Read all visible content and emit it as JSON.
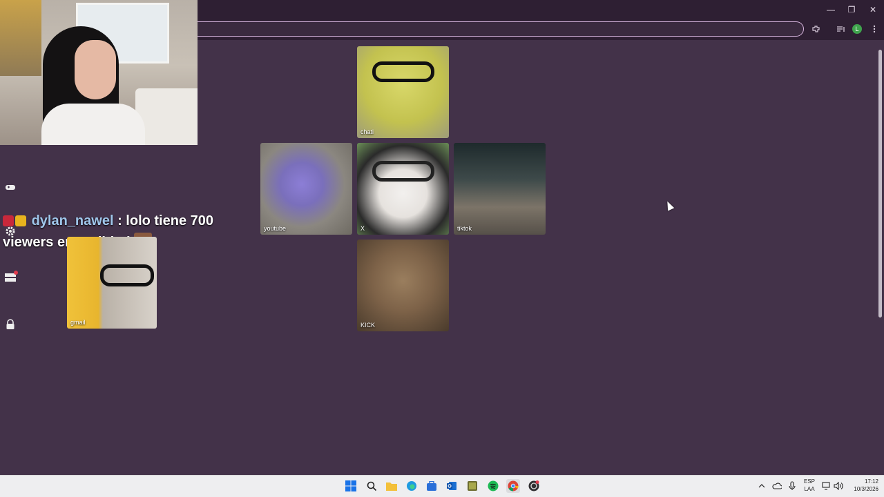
{
  "window": {
    "minimize_glyph": "—",
    "maximize_glyph": "❐",
    "close_glyph": "✕"
  },
  "toolbar": {
    "address_value": "",
    "icons": [
      "extensions-icon",
      "media-control-icon",
      "profile-avatar",
      "menu-icon"
    ],
    "profile_initial": "L"
  },
  "chat": {
    "username": "dylan_nawel",
    "separator": ":",
    "message_line1": "lolo tiene 700",
    "message_line2": "viewers en realidad"
  },
  "tiles": [
    {
      "label": "chati"
    },
    {
      "label": "youtube"
    },
    {
      "label": "X"
    },
    {
      "label": "tiktok"
    },
    {
      "label": "KICK"
    },
    {
      "label": "gmail"
    }
  ],
  "taskbar": {
    "apps": [
      "windows-start-icon",
      "search-icon",
      "file-explorer-icon",
      "edge-icon",
      "store-icon",
      "outlook-icon",
      "game-app-icon",
      "spotify-icon",
      "chrome-icon",
      "obs-icon"
    ],
    "language_top": "ESP",
    "language_bottom": "LAA",
    "time": "17:12",
    "date": "10/3/2026"
  },
  "colors": {
    "page_background": "#433249",
    "chrome_frame": "#2e1f33",
    "omnibox_border": "#d9b7e0",
    "username": "#9fc6ea"
  }
}
